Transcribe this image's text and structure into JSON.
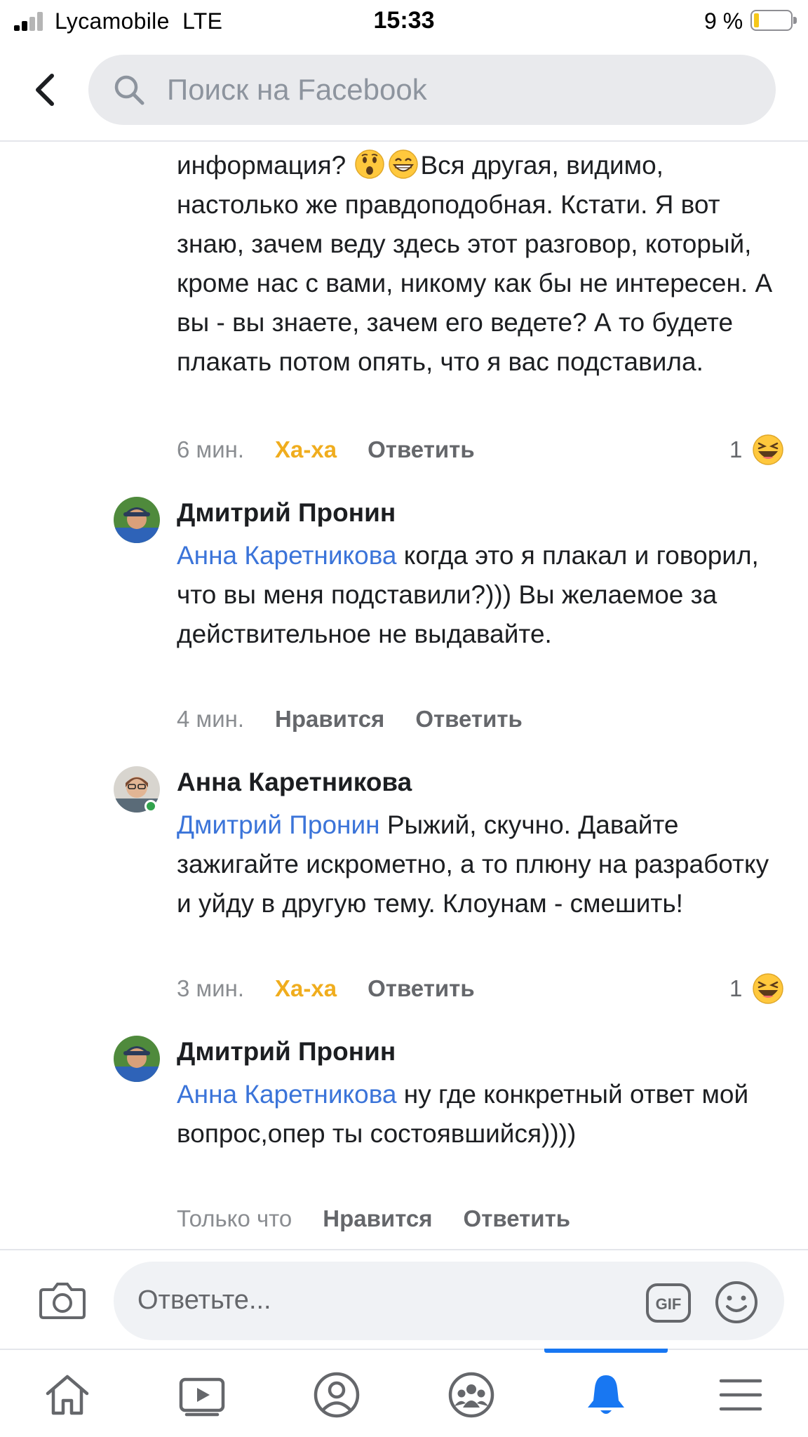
{
  "status_bar": {
    "carrier": "Lycamobile",
    "network": "LTE",
    "time": "15:33",
    "battery_percent": "9 %",
    "battery_level": 0.09
  },
  "header": {
    "search_placeholder": "Поиск на Facebook",
    "back_icon": "chevron-left-icon",
    "search_icon": "magnifier-icon"
  },
  "comments": [
    {
      "text_before_emoji": "информация? ",
      "emojis": [
        "astonished-face-emoji",
        "grinning-face-emoji"
      ],
      "text_after_emoji": "Вся другая, видимо, настолько же правдоподобная. Кстати. Я вот знаю, зачем веду здесь этот разговор, который, кроме нас с вами, никому как бы не интересен. А вы - вы знаете, зачем его ведете? А то будете плакать потом опять, что я вас подставила.",
      "time": "6 мин.",
      "reaction_action": "Ха-ха",
      "reply_action": "Ответить",
      "reaction_count": "1"
    },
    {
      "author": "Дмитрий Пронин",
      "mention": "Анна Каретникова",
      "text": " когда это я плакал и говорил, что вы меня подставили?))) Вы желаемое за действительное не выдавайте.",
      "time": "4 мин.",
      "like_action": "Нравится",
      "reply_action": "Ответить"
    },
    {
      "author": "Анна Каретникова",
      "mention": "Дмитрий Пронин",
      "text": " Рыжий, скучно. Давайте зажигайте искрометно, а то плюну на разработку и уйду в другую тему. Клоунам - смешить!",
      "time": "3 мин.",
      "reaction_action": "Ха-ха",
      "reply_action": "Ответить",
      "reaction_count": "1"
    },
    {
      "author": "Дмитрий Пронин",
      "mention": "Анна Каретникова",
      "text": " ну где конкретный ответ мой вопрос,опер ты состоявшийся))))",
      "time": "Только что",
      "like_action": "Нравится",
      "reply_action": "Ответить"
    }
  ],
  "reply_bar": {
    "placeholder": "Ответьте...",
    "gif_label": "GIF"
  },
  "nav": {
    "tabs": [
      "home-icon",
      "video-icon",
      "profile-icon",
      "groups-icon",
      "notifications-icon",
      "menu-icon"
    ],
    "active_tab": "notifications-icon"
  },
  "colors": {
    "mention": "#3b74d9",
    "haha": "#f0ad1e",
    "active_tab": "#1877f2",
    "online": "#31a24c"
  }
}
